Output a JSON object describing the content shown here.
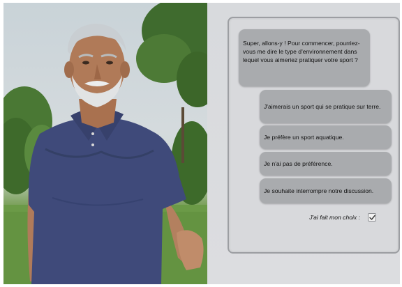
{
  "avatar": {
    "icon": "avatar-character"
  },
  "dialogue": {
    "question": "Super, allons-y ! Pour commencer, pourriez-vous me dire le type d'environnement dans lequel vous aimeriez pratiquer votre sport ?",
    "choices": [
      {
        "label": "J'aimerais un sport qui se pratique sur terre."
      },
      {
        "label": "Je préfère un sport aquatique."
      },
      {
        "label": "Je n'ai pas de préférence."
      },
      {
        "label": "Je souhaite interrompre notre discussion."
      }
    ],
    "confirm_label": "J'ai fait mon choix :",
    "confirm_checked": true
  },
  "colors": {
    "bubble": "#a9abae",
    "panel": "#d8d9dc",
    "panel_border": "#9c9ea2"
  }
}
